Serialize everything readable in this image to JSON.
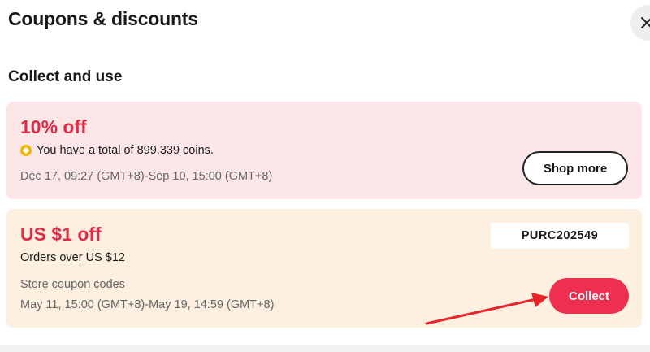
{
  "panel": {
    "title": "Coupons & discounts",
    "close_icon": "close-icon"
  },
  "section": {
    "title": "Collect and use"
  },
  "coupons": [
    {
      "headline": "10% off",
      "coin_icon": "coin-icon",
      "detail": "You have a total of 899,339 coins.",
      "validity": "Dec 17, 09:27 (GMT+8)-Sep 10, 15:00 (GMT+8)",
      "button_label": "Shop more",
      "background": "#fde6e8"
    },
    {
      "headline": "US $1 off",
      "detail": "Orders over US $12",
      "note": "Store coupon codes",
      "validity": "May 11, 15:00 (GMT+8)-May 19, 14:59 (GMT+8)",
      "code": "PURC202549",
      "button_label": "Collect",
      "background": "#fdf0e1"
    }
  ],
  "colors": {
    "accent": "#e02b47",
    "collect_button": "#ef2f4f",
    "annotation_arrow": "#e8232a"
  }
}
